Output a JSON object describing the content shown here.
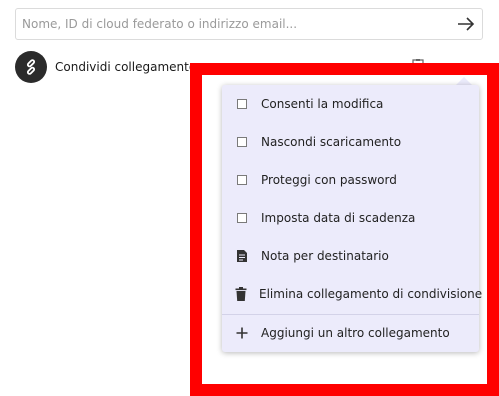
{
  "share": {
    "placeholder": "Nome, ID di cloud federato o indirizzo email...",
    "value": ""
  },
  "link": {
    "label": "Condividi collegamento"
  },
  "menu": {
    "items": [
      {
        "label": "Consenti la modifica",
        "icon": "checkbox",
        "checked": false
      },
      {
        "label": "Nascondi scaricamento",
        "icon": "checkbox",
        "checked": false
      },
      {
        "label": "Proteggi con password",
        "icon": "checkbox",
        "checked": false
      },
      {
        "label": "Imposta data di scadenza",
        "icon": "checkbox",
        "checked": false
      },
      {
        "label": "Nota per destinatario",
        "icon": "note-icon"
      },
      {
        "label": "Elimina collegamento di condivisione",
        "icon": "trash-icon"
      },
      {
        "label": "Aggiungi un altro collegamento",
        "icon": "plus-icon"
      }
    ]
  },
  "colors": {
    "highlight": "#ff0000",
    "menu_background": "#ecebfb",
    "avatar": "#2b2b2b"
  }
}
